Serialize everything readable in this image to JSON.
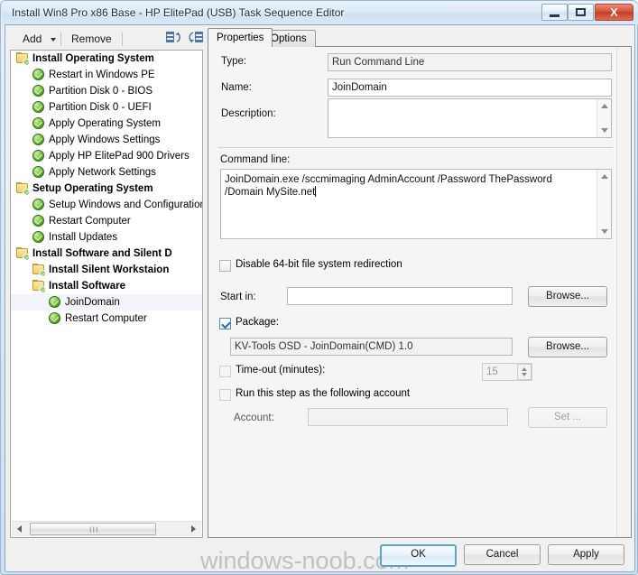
{
  "window": {
    "title": "Install Win8 Pro x86 Base - HP ElitePad (USB) Task Sequence Editor",
    "minimize_label": "Minimize",
    "maximize_label": "Maximize",
    "close_label": "X"
  },
  "toolbar": {
    "add_label": "Add",
    "add_dropdown_icon": "chevron-down-icon",
    "remove_label": "Remove",
    "move_up_icon": "move-up-icon",
    "move_down_icon": "move-down-icon"
  },
  "tree": {
    "items": [
      {
        "label": "Install Operating System",
        "icon": "folder-checked-icon",
        "level": 0,
        "bold": true,
        "selected": false
      },
      {
        "label": "Restart in Windows PE",
        "icon": "green-check-icon",
        "level": 1,
        "bold": false,
        "selected": false
      },
      {
        "label": "Partition Disk 0 - BIOS",
        "icon": "green-check-icon",
        "level": 1,
        "bold": false,
        "selected": false
      },
      {
        "label": "Partition Disk 0 - UEFI",
        "icon": "green-check-icon",
        "level": 1,
        "bold": false,
        "selected": false
      },
      {
        "label": "Apply Operating System",
        "icon": "green-check-icon",
        "level": 1,
        "bold": false,
        "selected": false
      },
      {
        "label": "Apply Windows Settings",
        "icon": "green-check-icon",
        "level": 1,
        "bold": false,
        "selected": false
      },
      {
        "label": "Apply HP ElitePad 900 Drivers",
        "icon": "green-check-icon",
        "level": 1,
        "bold": false,
        "selected": false
      },
      {
        "label": "Apply Network Settings",
        "icon": "green-check-icon",
        "level": 1,
        "bold": false,
        "selected": false
      },
      {
        "label": "Setup Operating System",
        "icon": "folder-checked-icon",
        "level": 0,
        "bold": true,
        "selected": false
      },
      {
        "label": "Setup Windows and Configuration",
        "icon": "green-check-icon",
        "level": 1,
        "bold": false,
        "selected": false
      },
      {
        "label": "Restart Computer",
        "icon": "green-check-icon",
        "level": 1,
        "bold": false,
        "selected": false
      },
      {
        "label": "Install Updates",
        "icon": "green-check-icon",
        "level": 1,
        "bold": false,
        "selected": false
      },
      {
        "label": "Install Software and Silent D",
        "icon": "folder-checked-icon",
        "level": 0,
        "bold": true,
        "selected": false
      },
      {
        "label": "Install Silent Workstaion",
        "icon": "folder-checked-icon",
        "level": 1,
        "bold": true,
        "selected": false
      },
      {
        "label": "Install Software",
        "icon": "folder-checked-icon",
        "level": 1,
        "bold": true,
        "selected": false
      },
      {
        "label": "JoinDomain",
        "icon": "green-check-icon",
        "level": 2,
        "bold": false,
        "selected": true
      },
      {
        "label": "Restart Computer",
        "icon": "green-check-icon",
        "level": 2,
        "bold": false,
        "selected": false
      }
    ],
    "hscroll": {
      "left_arrow_icon": "arrow-left-icon",
      "right_arrow_icon": "arrow-right-icon",
      "grip": "III"
    }
  },
  "tabs": [
    {
      "label": "Properties",
      "active": true
    },
    {
      "label": "Options",
      "active": false
    }
  ],
  "properties": {
    "type_label": "Type:",
    "type_value": "Run Command Line",
    "name_label": "Name:",
    "name_value": "JoinDomain",
    "name_placeholder": "",
    "description_label": "Description:",
    "description_value": "",
    "description_placeholder": "",
    "command_line_label": "Command line:",
    "command_line_value": "JoinDomain.exe /sccmimaging AdminAccount /Password ThePassword /Domain MySite.net",
    "disable_redirection_label": "Disable 64-bit file system redirection",
    "disable_redirection_checked": false,
    "start_in_label": "Start in:",
    "start_in_value": "",
    "browse_1_label": "Browse...",
    "package_label": "Package:",
    "package_checked": true,
    "package_value": "KV-Tools OSD - JoinDomain(CMD) 1.0",
    "browse_2_label": "Browse...",
    "timeout_label": "Time-out (minutes):",
    "timeout_checked": false,
    "timeout_value": "15",
    "run_as_label": "Run this step as the following account",
    "run_as_checked": false,
    "account_label": "Account:",
    "account_value": "",
    "set_label": "Set ..."
  },
  "footer": {
    "ok_label": "OK",
    "cancel_label": "Cancel",
    "apply_label": "Apply",
    "watermark": "windows-noob.com"
  },
  "colors": {
    "accent": "#5ba2cf",
    "close_button": "#c23d27",
    "check_green": "#4f9b20",
    "folder_tan": "#f2cf6d"
  }
}
